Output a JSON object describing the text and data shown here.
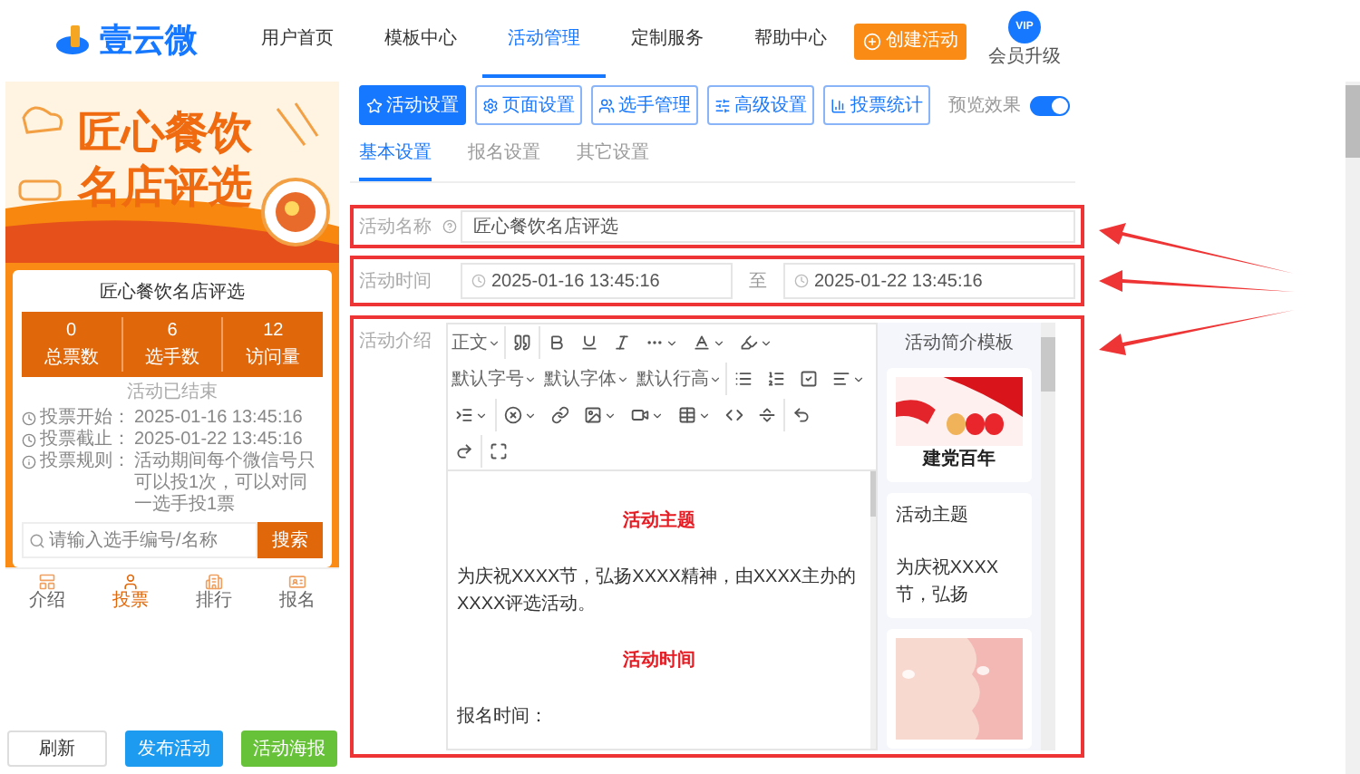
{
  "header": {
    "logo": "壹云微",
    "nav": [
      {
        "label": "用户首页",
        "selected": false
      },
      {
        "label": "模板中心",
        "selected": false
      },
      {
        "label": "活动管理",
        "selected": true
      },
      {
        "label": "定制服务",
        "selected": false
      },
      {
        "label": "帮助中心",
        "selected": false
      }
    ],
    "create_button": "创建活动",
    "vip_badge": "VIP",
    "vip_label": "会员升级"
  },
  "preview": {
    "banner_lines": [
      "匠心餐饮",
      "名店评选"
    ],
    "title": "匠心餐饮名店评选",
    "stats": [
      {
        "value": "0",
        "label": "总票数"
      },
      {
        "value": "6",
        "label": "选手数"
      },
      {
        "value": "12",
        "label": "访问量"
      }
    ],
    "status": "活动已结束",
    "info": [
      {
        "label": "投票开始：",
        "value": "2025-01-16 13:45:16",
        "kind": "clock"
      },
      {
        "label": "投票截止：",
        "value": "2025-01-22 13:45:16",
        "kind": "clock"
      },
      {
        "label": "投票规则：",
        "value": "活动期间每个微信号只可以投1次，可以对同一选手投1票",
        "kind": "info"
      }
    ],
    "search": {
      "placeholder": "请输入选手编号/名称",
      "button": "搜索"
    },
    "bottom_tabs": [
      {
        "label": "介绍",
        "selected": false
      },
      {
        "label": "投票",
        "selected": true
      },
      {
        "label": "排行",
        "selected": false
      },
      {
        "label": "报名",
        "selected": false
      }
    ]
  },
  "actions": [
    {
      "label": "刷新",
      "kind": "plain"
    },
    {
      "label": "发布活动",
      "kind": "primary"
    },
    {
      "label": "活动海报",
      "kind": "success"
    }
  ],
  "settings_tabs": [
    {
      "label": "活动设置",
      "selected": true
    },
    {
      "label": "页面设置",
      "selected": false
    },
    {
      "label": "选手管理",
      "selected": false
    },
    {
      "label": "高级设置",
      "selected": false
    },
    {
      "label": "投票统计",
      "selected": false
    }
  ],
  "preview_toggle": {
    "label": "预览效果",
    "on": true
  },
  "sub_tabs": [
    {
      "label": "基本设置",
      "selected": true
    },
    {
      "label": "报名设置",
      "selected": false
    },
    {
      "label": "其它设置",
      "selected": false
    }
  ],
  "form": {
    "name_label": "活动名称",
    "name_value": "匠心餐饮名店评选",
    "time_label": "活动时间",
    "start": "2025-01-16 13:45:16",
    "separator": "至",
    "end": "2025-01-22 13:45:16",
    "intro_label": "活动介绍"
  },
  "editor": {
    "dropdowns": [
      "正文",
      "默认字号",
      "默认字体",
      "默认行高"
    ],
    "content": [
      {
        "kind": "heading",
        "text": "活动主题"
      },
      {
        "kind": "paragraph",
        "text": "为庆祝XXXX节，弘扬XXXX精神，由XXXX主办的XXXX评选活动。"
      },
      {
        "kind": "heading",
        "text": "活动时间"
      },
      {
        "kind": "paragraph",
        "text": "报名时间："
      }
    ]
  },
  "templates": {
    "title": "活动简介模板",
    "items": [
      {
        "kind": "picture",
        "caption": "建党百年"
      },
      {
        "kind": "text",
        "heading": "活动主题",
        "body": "为庆祝XXXX节，弘扬"
      },
      {
        "kind": "picture"
      }
    ]
  }
}
